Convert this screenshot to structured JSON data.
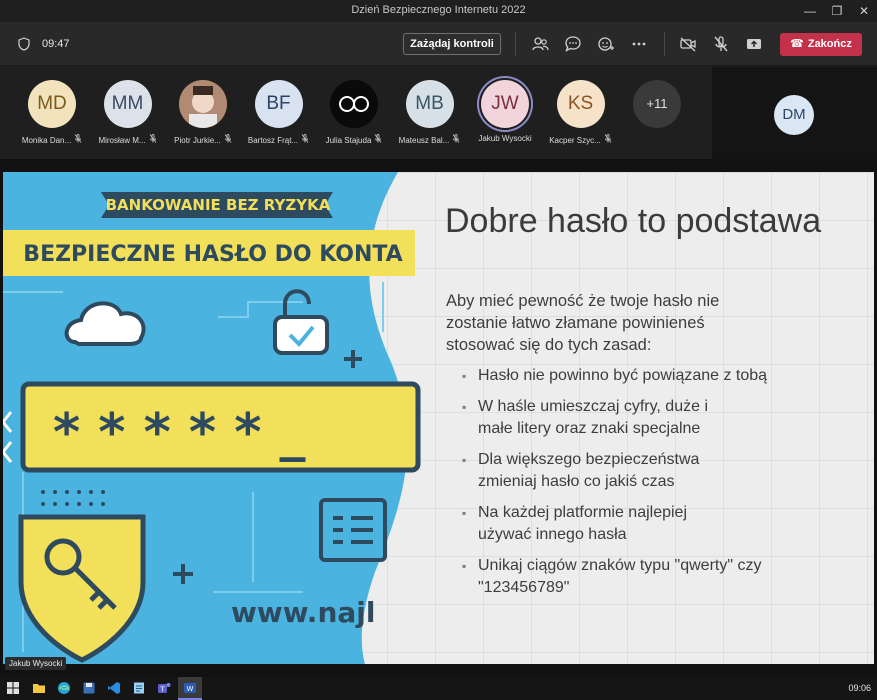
{
  "window": {
    "title": "Dzień Bezpiecznego Internetu 2022"
  },
  "toolbar": {
    "elapsed": "09:47",
    "request_control": "Zażądaj kontroli",
    "end_call": "Zakończ"
  },
  "participants": [
    {
      "initials": "MD",
      "name": "Monika Dan...",
      "bg": "#f2e3bd",
      "fg": "#7a5a1c",
      "muted": true
    },
    {
      "initials": "MM",
      "name": "Mirosław M...",
      "bg": "#dce1ea",
      "fg": "#3c4a63",
      "muted": true
    },
    {
      "initials": "",
      "name": "Piotr Jurkie...",
      "bg": "#8f6e5a",
      "fg": "#ffffff",
      "muted": true,
      "photo": true
    },
    {
      "initials": "BF",
      "name": "Bartosz Frąt...",
      "bg": "#d8e2f1",
      "fg": "#2c4566",
      "muted": true
    },
    {
      "initials": "",
      "name": "Julia Stajuda",
      "bg": "#0a0a0a",
      "fg": "#ffffff",
      "muted": true,
      "logo": true
    },
    {
      "initials": "MB",
      "name": "Mateusz Bal...",
      "bg": "#d6e0e6",
      "fg": "#3b5566",
      "muted": true
    },
    {
      "initials": "JW",
      "name": "Jakub Wysocki",
      "bg": "#f2d4dc",
      "fg": "#7a2f45",
      "muted": false,
      "speaking": true
    },
    {
      "initials": "KS",
      "name": "Kacper Szyc...",
      "bg": "#f6e2c9",
      "fg": "#8a5523",
      "muted": true
    }
  ],
  "more_participants": "+11",
  "self_view": {
    "initials": "DM"
  },
  "slide": {
    "ribbon_top": "BANKOWANIE BEZ RYZYKA",
    "banner": "BEZPIECZNE HASŁO DO KONTA",
    "password_mask": "* * * * * _",
    "url_fragment": "www.najl",
    "heading": "Dobre hasło to podstawa",
    "intro": "Aby mieć pewność że twoje hasło nie zostanie łatwo złamane powinieneś stosować się do tych zasad:",
    "bullets": [
      "Hasło nie powinno być powiązane z tobą",
      "W haśle umieszczaj cyfry, duże i małe litery oraz znaki specjalne",
      "Dla większego bezpieczeństwa zmieniaj hasło co jakiś czas",
      "Na każdej platformie najlepiej używać innego hasła",
      "Unikaj ciągów znaków typu \"qwerty\" czy \"123456789\""
    ],
    "presenter": "Jakub Wysocki"
  },
  "taskbar": {
    "clock": "09:06"
  },
  "colors": {
    "end_call": "#c4314b",
    "slide_blue": "#4bb3e0",
    "slide_yellow": "#f2df5a",
    "slide_navy": "#2e4a5f"
  }
}
